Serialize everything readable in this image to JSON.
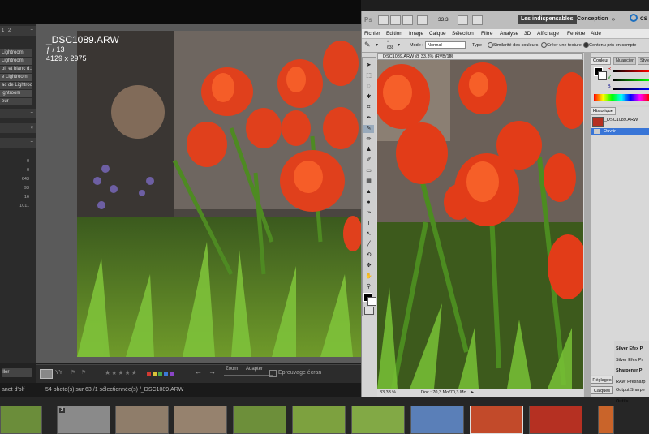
{
  "lightroom": {
    "left_panel": {
      "header_numbers": [
        "1",
        "2"
      ],
      "presets": [
        "Lightroom",
        "Lightroom",
        "oir et blanc d...",
        "e Lightroom",
        "ac de Lightroo...",
        "ightroom",
        "eur"
      ],
      "histogram_values": [
        "0",
        "0",
        "643",
        "93",
        "16",
        "1011"
      ],
      "bottom_button": "iller"
    },
    "photo": {
      "filename": "_DSC1089.ARW",
      "aperture": "ƒ / 13",
      "dimensions": "4129 x 2975"
    },
    "toolbar": {
      "view_mode": "YY",
      "zoom_label": "Zoom",
      "fit_label": "Adapter",
      "proof_label": "Epreuvage écran",
      "color_labels": [
        "#d23a32",
        "#d8c33a",
        "#4aa64a",
        "#3b7ad8",
        "#8a45c6"
      ]
    },
    "info_bar": {
      "catalog": "anet d'olf",
      "count": "54 photo(s) sur 63 /1 sélectionnée(s) /_DSC1089.ARW"
    },
    "filmstrip": {
      "badge": "2"
    }
  },
  "photoshop": {
    "title": {
      "ps_logo": "Ps",
      "zoom": "33,3",
      "essentials": "Les indispensables",
      "design": "Conception",
      "cs_live": "CS"
    },
    "menu": [
      "Fichier",
      "Edition",
      "Image",
      "Calque",
      "Sélection",
      "Filtre",
      "Analyse",
      "3D",
      "Affichage",
      "Fenêtre",
      "Aide"
    ],
    "options": {
      "brush_size": "638",
      "mode_label": "Mode :",
      "mode_value": "Normal",
      "type_label": "Type :",
      "opt1": "Similarité des couleurs",
      "opt2": "Créer une texture",
      "opt3": "Contenu pris en compte"
    },
    "document": {
      "tab": "_DSC1089.ARW @ 33,3% (RVB/16)",
      "zoom": "33,33 %",
      "status": "Doc : 70,3 Mo/70,3 Mo"
    },
    "panels": {
      "color_tabs": [
        "Couleur",
        "Nuancier",
        "Style"
      ],
      "color_channels": [
        "R",
        "V",
        "B"
      ],
      "history_tab": "Historique",
      "history_items": [
        "_DSC1089.ARW",
        "Ouvrir"
      ],
      "buttons": [
        "Réglages",
        "Calques"
      ]
    },
    "plugins": [
      "Silver Efex P",
      "Silver Efex Pr",
      "Sharpener P",
      "RAW Presharp",
      "Output Sharpe",
      "Outils"
    ]
  }
}
